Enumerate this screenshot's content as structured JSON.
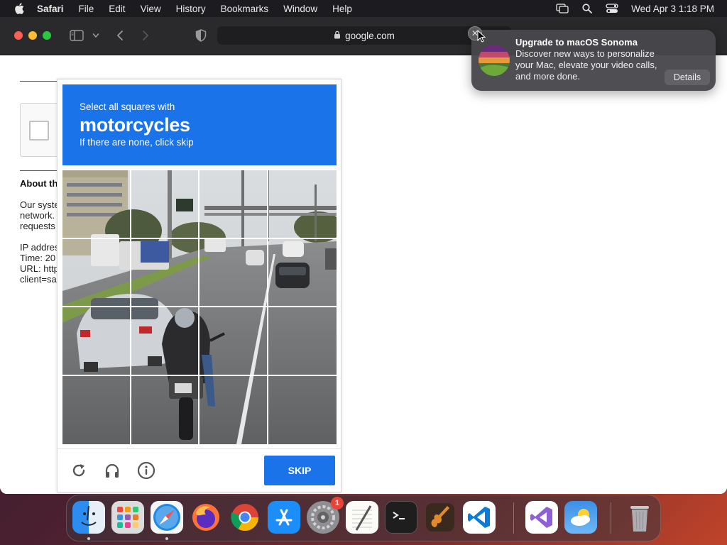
{
  "menubar": {
    "app_name": "Safari",
    "items": [
      "File",
      "Edit",
      "View",
      "History",
      "Bookmarks",
      "Window",
      "Help"
    ],
    "clock": "Wed Apr 3  1:18 PM"
  },
  "browser": {
    "address": "google.com"
  },
  "page": {
    "about_heading": "About th",
    "lines": [
      "Our syste",
      "network.",
      "requests",
      "",
      "IP addres",
      "Time: 20",
      "URL: http",
      "client=sa"
    ]
  },
  "captcha": {
    "instruction_line1": "Select all squares with",
    "target": "motorcycles",
    "instruction_line3": "If there are none, click skip",
    "skip_label": "SKIP"
  },
  "notification": {
    "title": "Upgrade to macOS Sonoma",
    "message": "Discover new ways to personalize your Mac, elevate your video calls, and more done.",
    "details_label": "Details"
  },
  "dock": {
    "items": [
      "Finder",
      "Launchpad",
      "Safari",
      "Firefox",
      "Chrome",
      "App Store",
      "System Settings",
      "TextEdit",
      "Terminal",
      "GarageBand",
      "Visual Studio Code",
      "Visual Studio",
      "Weather",
      "Trash"
    ],
    "settings_badge": "1"
  },
  "colors": {
    "captcha_blue": "#1a73e8",
    "menubar_bg": "#1c1b1f",
    "toolbar_bg": "#2a2a2c"
  }
}
